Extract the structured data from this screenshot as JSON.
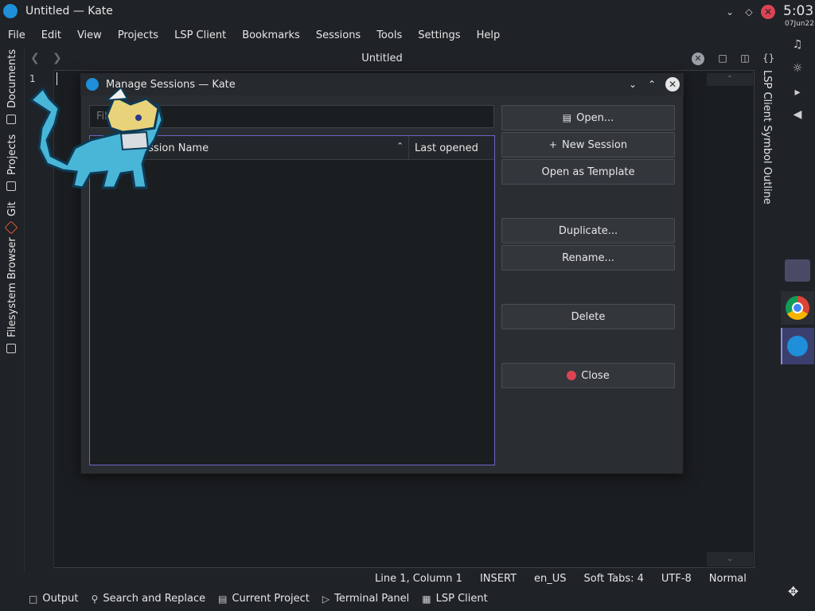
{
  "window": {
    "title": "Untitled — Kate"
  },
  "menubar": {
    "items": [
      "File",
      "Edit",
      "View",
      "Projects",
      "LSP Client",
      "Bookmarks",
      "Sessions",
      "Tools",
      "Settings",
      "Help"
    ]
  },
  "tab": {
    "title": "Untitled"
  },
  "left_sidebar": {
    "tabs": [
      "Documents",
      "Projects",
      "Git",
      "Filesystem Browser"
    ]
  },
  "right_sidebar": {
    "label": "LSP Client Symbol Outline"
  },
  "editor": {
    "line_number": "1"
  },
  "tray": {
    "time": "5:03",
    "date": "07Jun22"
  },
  "dialog": {
    "title": "Manage Sessions — Kate",
    "filter_placeholder": "Filter...",
    "columns": {
      "name": "Session Name",
      "last_opened": "Last opened"
    },
    "buttons": {
      "open": "Open...",
      "new_session": "New Session",
      "open_as_template": "Open as Template",
      "duplicate": "Duplicate...",
      "rename": "Rename...",
      "delete": "Delete",
      "close": "Close"
    }
  },
  "statusbar": {
    "position": "Line 1, Column 1",
    "mode": "INSERT",
    "language": "en_US",
    "indent": "Soft Tabs: 4",
    "encoding": "UTF-8",
    "input_mode": "Normal"
  },
  "bottom_panels": {
    "output": "Output",
    "search_replace": "Search and Replace",
    "current_project": "Current Project",
    "terminal": "Terminal Panel",
    "lsp_client": "LSP Client"
  },
  "colors": {
    "background": "#1f2226",
    "editor_bg": "#1b1e21",
    "dialog_bg": "#2a2d31",
    "accent": "#6b66c5",
    "close_red": "#da4453",
    "kate_blue": "#1e8fd8"
  }
}
